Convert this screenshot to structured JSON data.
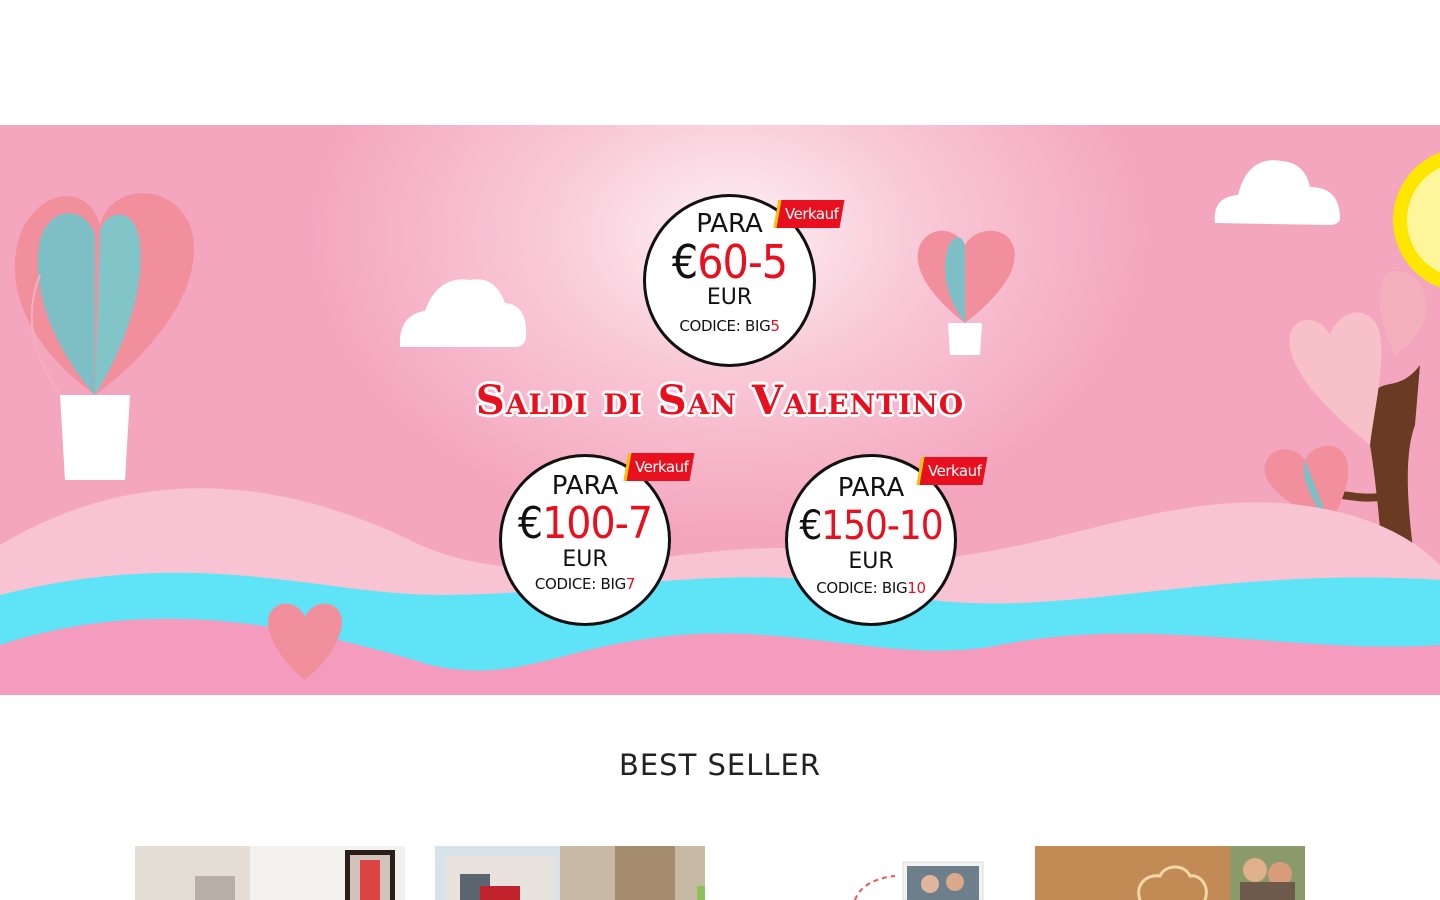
{
  "banner": {
    "headline": "Saldi di San Valentino",
    "coupons": [
      {
        "tag": "Verkauf",
        "para": "PARA",
        "currency": "€",
        "amount": "60-5",
        "eur": "EUR",
        "code_prefix": "CODICE: BIG",
        "code_suffix": "5"
      },
      {
        "tag": "Verkauf",
        "para": "PARA",
        "currency": "€",
        "amount": "100-7",
        "eur": "EUR",
        "code_prefix": "CODICE: BIG",
        "code_suffix": "7"
      },
      {
        "tag": "Verkauf",
        "para": "PARA",
        "currency": "€",
        "amount": "150-10",
        "eur": "EUR",
        "code_prefix": "CODICE: BIG",
        "code_suffix": "10"
      }
    ],
    "colors": {
      "accent_red": "#e8101e",
      "pink_bg": "#f4a6bf",
      "teal": "#5dd9f5",
      "tag_stripe": "#f4c700"
    }
  },
  "best_seller": {
    "title": "BEST SELLER",
    "products": [
      {
        "image": "framed-poster-room-photo"
      },
      {
        "image": "house-car-photo"
      },
      {
        "image": "couple-photo-print"
      },
      {
        "image": "couple-kiss-photo-gift"
      }
    ]
  }
}
